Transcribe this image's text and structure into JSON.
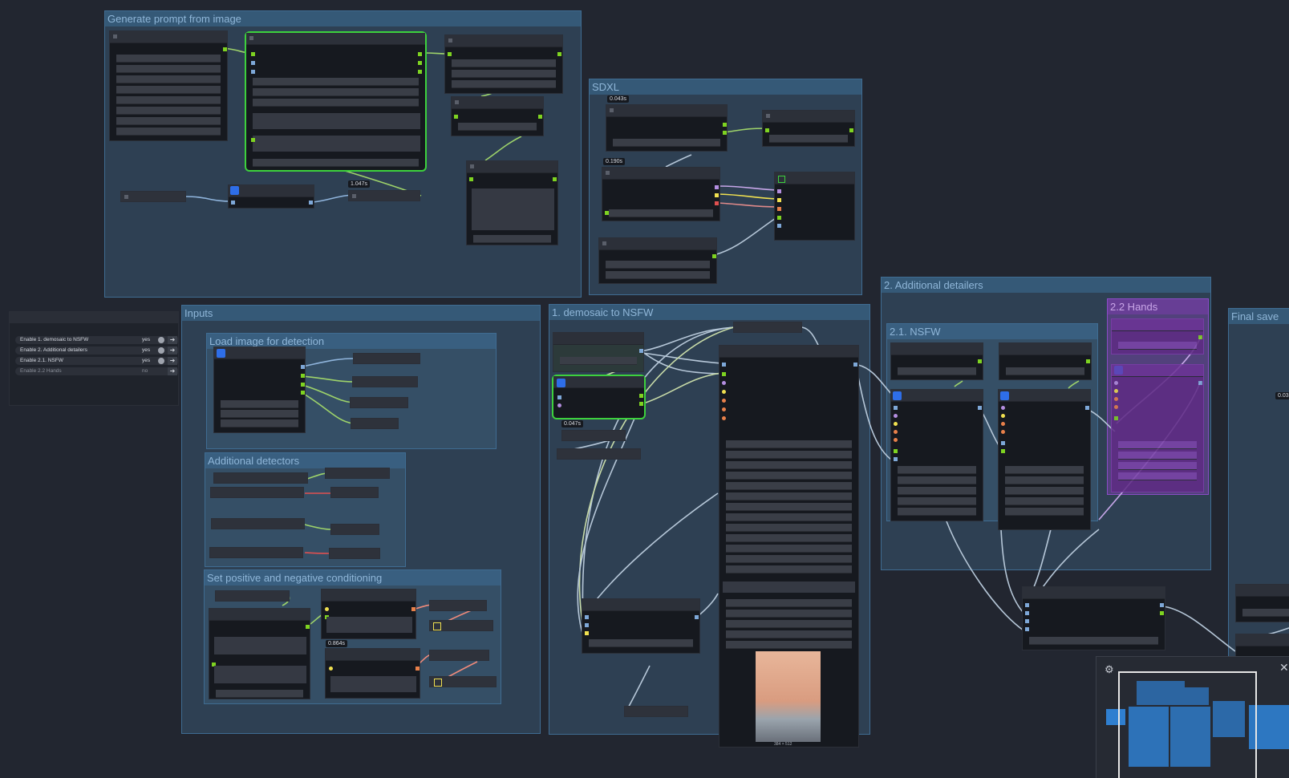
{
  "groups": {
    "generate_prompt": "Generate prompt from image",
    "sdxl": "SDXL",
    "inputs": "Inputs",
    "load_image": "Load image for detection",
    "additional_detectors": "Additional detectors",
    "conditioning": "Set positive and negative conditioning",
    "demosaic": "1. demosaic to NSFW",
    "additional_detailers": "2. Additional detailers",
    "nsfw": "2.1. NSFW",
    "hands": "2.2 Hands",
    "final_save": "Final save"
  },
  "timings": {
    "t1": "1.047s",
    "t2": "0.043s",
    "t3": "0.190s",
    "t4": "0.047s",
    "t5": "0.864s",
    "t6": "0.03"
  },
  "switches": [
    {
      "label": "Enable 1. demosaic to NSFW",
      "value": "yes"
    },
    {
      "label": "Enable 2. Additional detailers",
      "value": "yes"
    },
    {
      "label": "Enable 2.1. NSFW",
      "value": "yes"
    },
    {
      "label": "Enable 2.2 Hands",
      "value": "no"
    }
  ],
  "preview": {
    "caption": "384 × 512"
  },
  "minimap": {
    "settings_icon": "⚙",
    "close_icon": "✕"
  },
  "colors": {
    "background": "#222630",
    "group": "#3f6c92",
    "selected": "#3dd13d",
    "toggle": "#2e6ee8",
    "purple_group": "#8a4cc6"
  }
}
